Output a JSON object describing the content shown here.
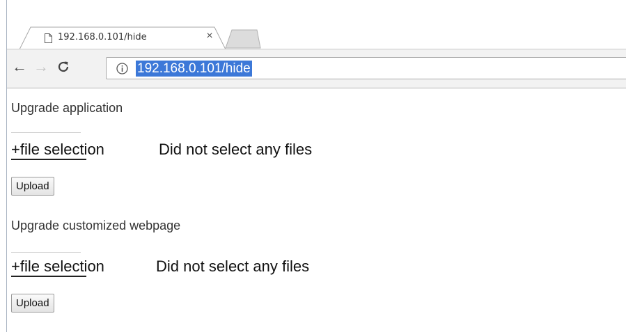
{
  "browser": {
    "tab": {
      "title": "192.168.0.101/hide",
      "close_label": "×"
    },
    "address_bar": {
      "url": "192.168.0.101/hide"
    },
    "icons": [
      "page-icon",
      "close-icon",
      "back-icon",
      "forward-icon",
      "reload-icon",
      "info-icon"
    ]
  },
  "page": {
    "sections": [
      {
        "title": "Upgrade application",
        "file_button_label": "+file selection",
        "file_status": "Did not select any files",
        "upload_label": "Upload"
      },
      {
        "title": "Upgrade customized webpage",
        "file_button_label": "+file selection",
        "file_status": "Did not select any files",
        "upload_label": "Upload"
      }
    ]
  },
  "colors": {
    "url_selection": "#3c78d8",
    "toolbar_bg": "#f2f2f2"
  }
}
